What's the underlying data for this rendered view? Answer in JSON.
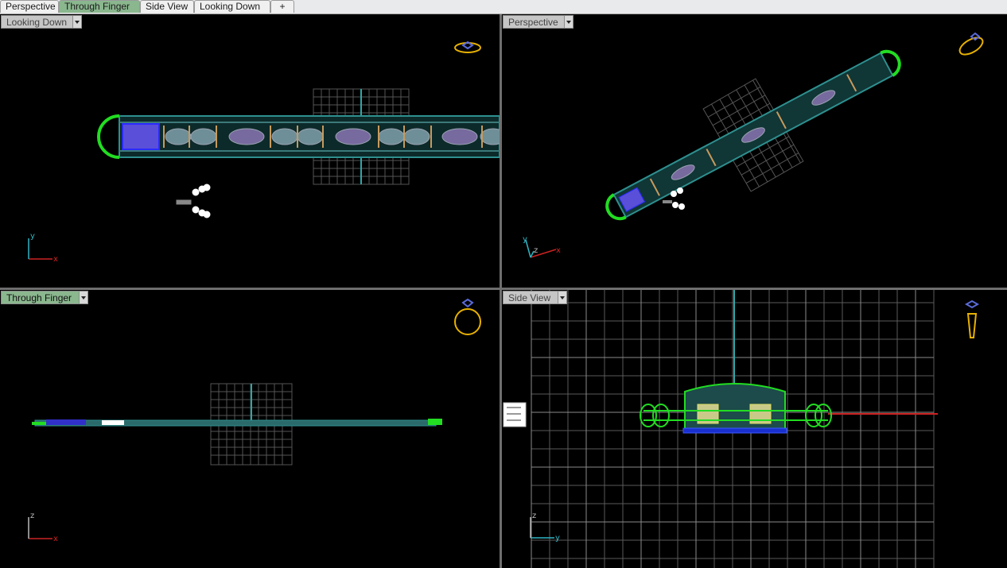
{
  "tabs": [
    {
      "label": "Perspective",
      "active": false
    },
    {
      "label": "Through Finger",
      "active": true
    },
    {
      "label": "Side View",
      "active": false
    },
    {
      "label": "Looking Down",
      "active": false
    }
  ],
  "add_tab_glyph": "+",
  "viewports": {
    "top_left": {
      "title": "Looking Down",
      "axes": [
        "y",
        "x"
      ],
      "nav_icon": "ring-top-icon"
    },
    "top_right": {
      "title": "Perspective",
      "axes": [
        "y",
        "z",
        "x"
      ],
      "nav_icon": "ring-perspective-icon"
    },
    "bottom_left": {
      "title": "Through Finger",
      "axes": [
        "z",
        "x"
      ],
      "nav_icon": "ring-front-icon"
    },
    "bottom_right": {
      "title": "Side View",
      "axes": [
        "z",
        "y"
      ],
      "nav_icon": "ring-side-icon"
    }
  },
  "colors": {
    "viewport_bg": "#000000",
    "active_tab": "#8ab78e",
    "grid": "#6b6b6b",
    "wire_green": "#22dd22",
    "wire_teal": "#2f8f8f",
    "link_purple": "#8a78b8",
    "ring_gold": "#e7b100",
    "axis_red": "#cc2222",
    "axis_cyan": "#2fb6c4"
  }
}
